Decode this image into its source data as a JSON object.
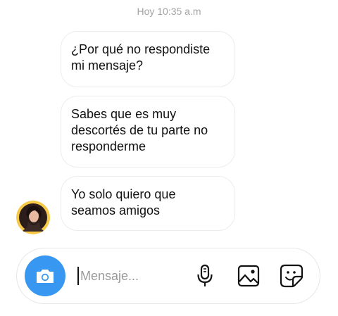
{
  "chat": {
    "timestamp": "Hoy 10:35 a.m",
    "messages": [
      {
        "lines": [
          "¿Por qué no respondiste",
          "mi mensaje?"
        ]
      },
      {
        "lines": [
          "Sabes que es muy",
          "descortés de tu parte no",
          "responderme"
        ]
      },
      {
        "lines": [
          "Yo solo quiero que",
          "seamos amigos"
        ]
      }
    ],
    "sender_avatar": "avatar-photo"
  },
  "composer": {
    "placeholder": "Mensaje...",
    "value": "",
    "icons": {
      "camera": "camera-icon",
      "mic": "microphone-icon",
      "gallery": "image-icon",
      "sticker": "sticker-icon"
    }
  },
  "colors": {
    "accent": "#3897f0",
    "bubble_border": "#ececec",
    "timestamp": "#a3a3a3",
    "avatar_ring": "#f7c948"
  }
}
